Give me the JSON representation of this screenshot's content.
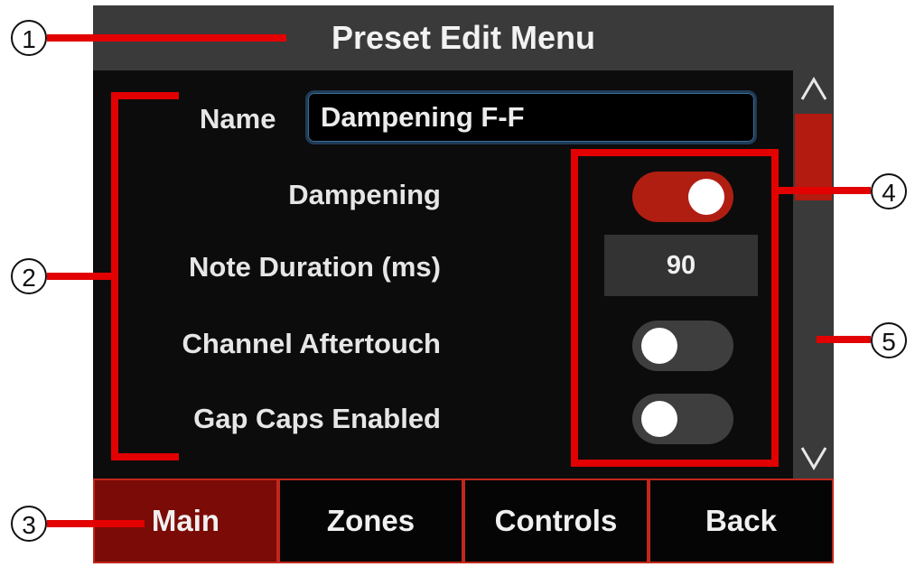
{
  "header": {
    "title": "Preset Edit Menu"
  },
  "preset": {
    "name_label": "Name",
    "name_value": "Dampening F-F"
  },
  "settings": {
    "dampening": {
      "label": "Dampening",
      "state": "on"
    },
    "note_duration": {
      "label": "Note Duration (ms)",
      "value": "90"
    },
    "channel_aftertouch": {
      "label": "Channel Aftertouch",
      "state": "off"
    },
    "gap_caps": {
      "label": "Gap Caps Enabled",
      "state": "off"
    }
  },
  "tabs": [
    {
      "label": "Main",
      "active": true
    },
    {
      "label": "Zones",
      "active": false
    },
    {
      "label": "Controls",
      "active": false
    },
    {
      "label": "Back",
      "active": false
    }
  ],
  "annotations": [
    "1",
    "2",
    "3",
    "4",
    "5"
  ],
  "colors": {
    "accent_red": "#b01e12",
    "active_tab": "#7a0b06",
    "annotation_red": "#e20000",
    "title_bar": "#3a3a3a"
  },
  "icons": {
    "scroll_up": "chevron-up-icon",
    "scroll_down": "chevron-down-icon"
  }
}
